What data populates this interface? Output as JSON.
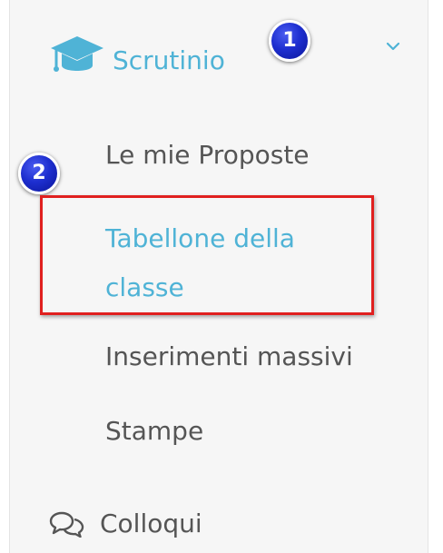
{
  "menu": {
    "header": {
      "label": "Scrutinio",
      "icon": "graduation-cap-icon",
      "toggle_icon": "chevron-down-icon"
    },
    "items": [
      {
        "label": "Le mie Proposte"
      },
      {
        "label": "Tabellone della classe",
        "active": true
      },
      {
        "label": "Inserimenti massivi"
      },
      {
        "label": "Stampe"
      }
    ],
    "next_section": {
      "label": "Colloqui",
      "icon": "comments-icon"
    }
  },
  "annotations": {
    "badge_1": "1",
    "badge_2": "2",
    "highlight_color": "#e0201f",
    "badge_color": "#1e2fd0"
  },
  "colors": {
    "accent": "#4fb3d6",
    "text": "#555555",
    "background": "#f6f6f6"
  }
}
